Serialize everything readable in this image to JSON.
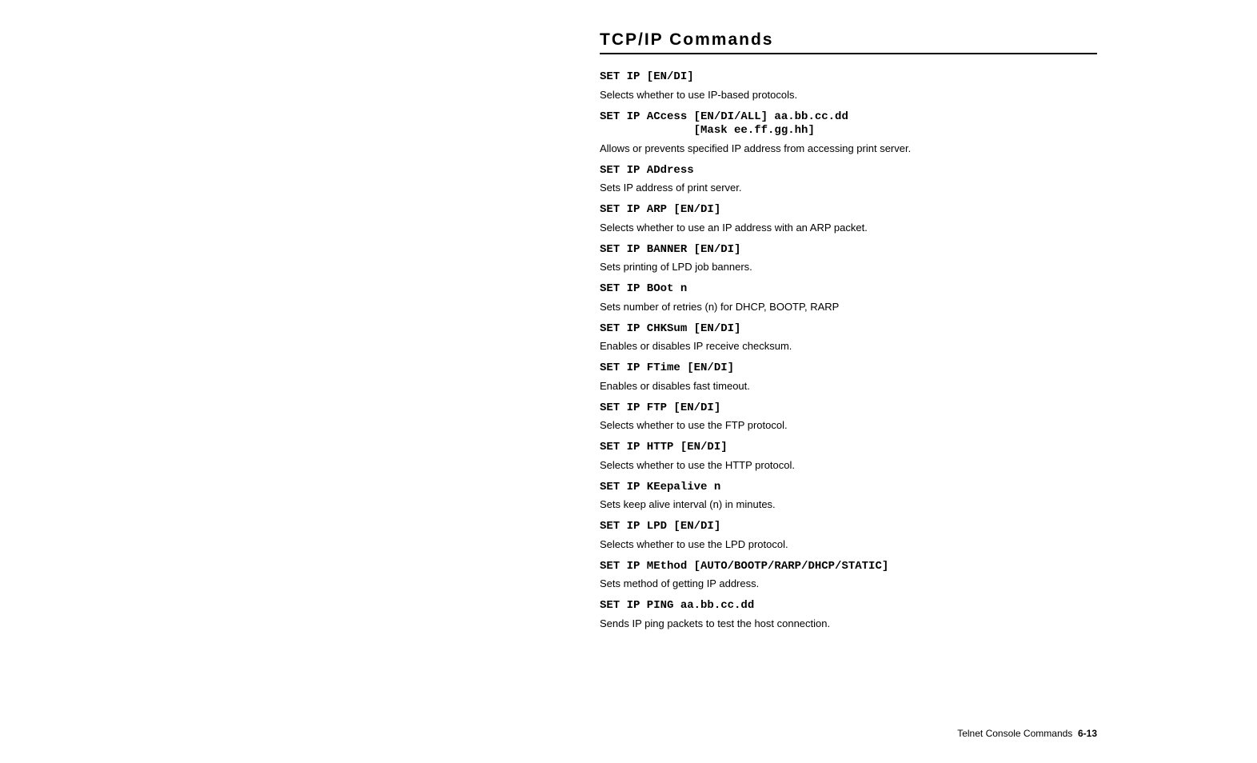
{
  "title": "TCP/IP Commands",
  "items": [
    {
      "cmd": "SET IP [EN/DI]",
      "desc": "Selects whether to use IP-based protocols."
    },
    {
      "cmd": "SET IP ACcess [EN/DI/ALL] aa.bb.cc.dd\n              [Mask ee.ff.gg.hh]",
      "desc": "Allows or prevents specified IP address from accessing print server."
    },
    {
      "cmd": "SET IP ADdress",
      "desc": "Sets IP address of print server."
    },
    {
      "cmd": "SET IP ARP [EN/DI]",
      "desc": "Selects whether to use an IP address with an ARP packet."
    },
    {
      "cmd": "SET IP BANNER [EN/DI]",
      "desc": "Sets printing of LPD job banners."
    },
    {
      "cmd": "SET IP BOot n",
      "desc": "Sets number of retries (n) for DHCP, BOOTP, RARP"
    },
    {
      "cmd": "SET IP CHKSum [EN/DI]",
      "desc": "Enables or disables IP receive checksum."
    },
    {
      "cmd": "SET IP FTime [EN/DI]",
      "desc": "Enables or disables fast timeout."
    },
    {
      "cmd": "SET IP FTP [EN/DI]",
      "desc": "Selects whether to use the FTP protocol."
    },
    {
      "cmd": "SET IP HTTP [EN/DI]",
      "desc": "Selects whether to use the HTTP protocol."
    },
    {
      "cmd": "SET IP KEepalive n",
      "desc": "Sets keep alive interval (n) in minutes."
    },
    {
      "cmd": "SET IP LPD [EN/DI]",
      "desc": "Selects whether to use the LPD protocol."
    },
    {
      "cmd": "SET IP MEthod [AUTO/BOOTP/RARP/DHCP/STATIC]",
      "desc": "Sets method of getting IP address."
    },
    {
      "cmd": "SET IP PING aa.bb.cc.dd",
      "desc": "Sends IP ping packets to test the host connection."
    }
  ],
  "footer": {
    "label": "Telnet Console Commands",
    "page": "6-13"
  }
}
